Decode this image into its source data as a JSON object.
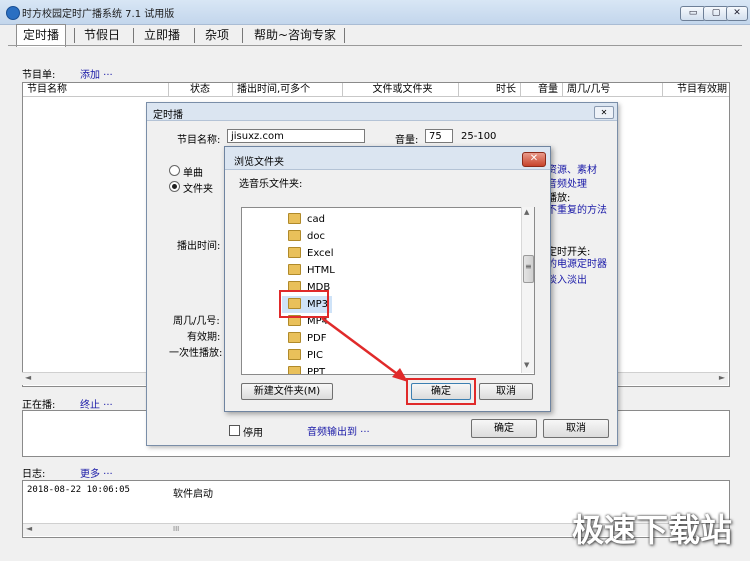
{
  "window": {
    "title": "时方校园定时广播系统 7.1 试用版",
    "buttons": [
      "▭",
      "▢",
      "✕"
    ]
  },
  "tabs": [
    "定时播",
    "节假日",
    "立即播",
    "杂项",
    "帮助~咨询专家"
  ],
  "program_list": {
    "label": "节目单:",
    "add_link": "添加 ···",
    "columns": [
      "节目名称",
      "状态",
      "播出时间,可多个",
      "文件或文件夹",
      "时长",
      "音量",
      "周几/几号",
      "节目有效期"
    ]
  },
  "now_playing": {
    "label": "正在播:",
    "stop_link": "终止 ···"
  },
  "log": {
    "label": "日志:",
    "more_link": "更多 ···",
    "entries": [
      {
        "time": "2018-08-22 10:06:05",
        "text": "软件启动"
      }
    ]
  },
  "dialog_schedule": {
    "title": "定时播",
    "close": "✕",
    "name_label": "节目名称:",
    "name_value": "jisuxz.com",
    "volume_label": "音量:",
    "volume_value": "75",
    "volume_range": "25-100",
    "radio_single": "单曲",
    "radio_folder": "文件夹",
    "airtime_label": "播出时间:",
    "weekday_label": "周几/几号:",
    "validity_label": "有效期:",
    "once_label": "一次性播放:",
    "right_texts": [
      "资源、素材",
      "音频处理",
      "播放:",
      "不重复的方法",
      "定时开关:",
      "的电源定时器",
      "淡入淡出"
    ],
    "disable_label": "停用",
    "audio_output_link": "音频输出到 ···",
    "ok_label": "确定",
    "cancel_label": "取消"
  },
  "dialog_browse": {
    "title": "浏览文件夹",
    "close": "✕",
    "prompt": "选音乐文件夹:",
    "folders": [
      "cad",
      "doc",
      "Excel",
      "HTML",
      "MDB",
      "MP3",
      "MP4",
      "PDF",
      "PIC",
      "PPT"
    ],
    "selected_folder": "MP3",
    "new_folder_label": "新建文件夹(M)",
    "ok_label": "确定",
    "cancel_label": "取消"
  },
  "scroll_glyphs": {
    "up": "▲",
    "down": "▼",
    "left": "◄",
    "right": "►",
    "grip": "≡",
    "hgrip": "III"
  },
  "accent_color": "#e02a2a",
  "watermark": "极速下载站"
}
